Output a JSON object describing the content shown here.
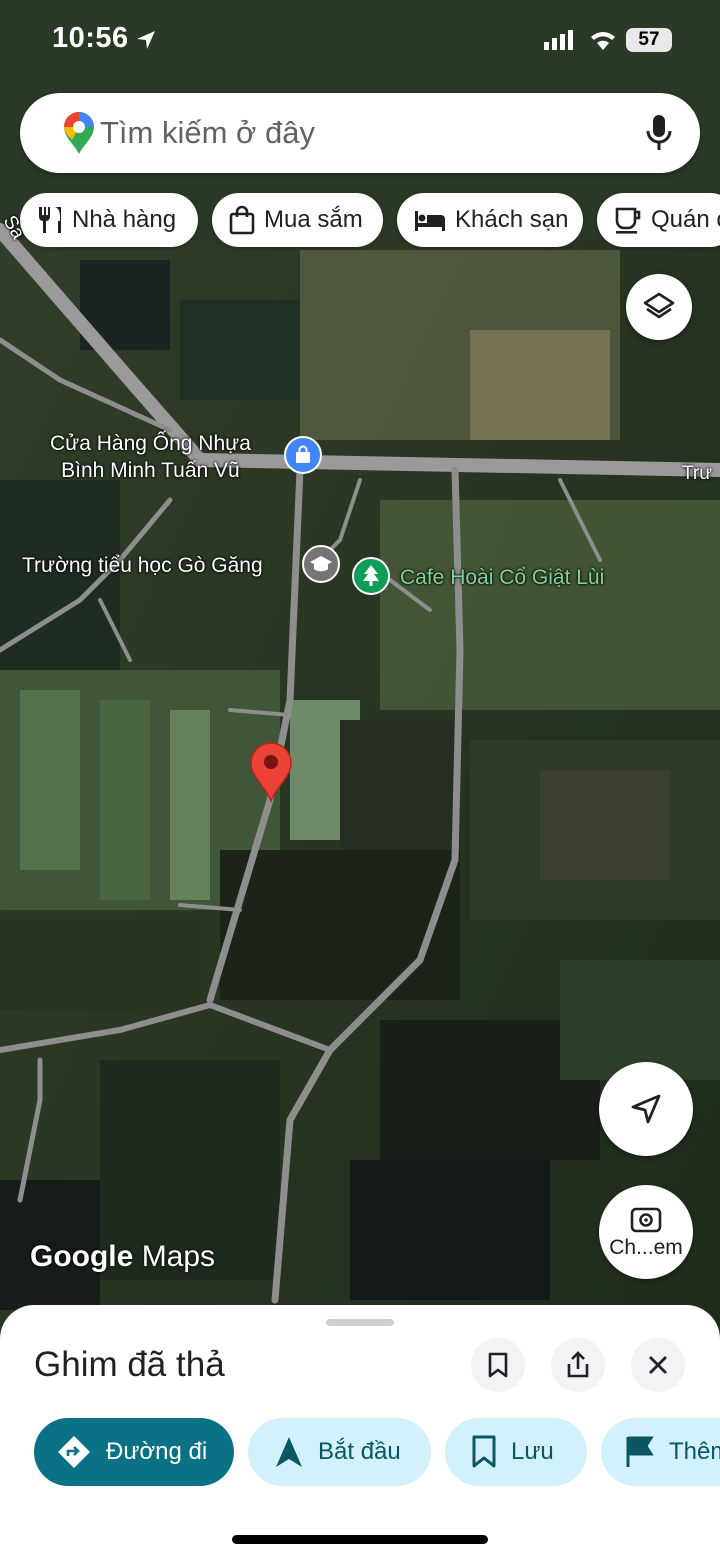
{
  "status_bar": {
    "time": "10:56",
    "battery": "57"
  },
  "search": {
    "placeholder": "Tìm kiếm ở đây"
  },
  "chips": [
    {
      "label": "Nhà hàng",
      "icon": "fork-knife-icon"
    },
    {
      "label": "Mua sắm",
      "icon": "shopping-bag-icon"
    },
    {
      "label": "Khách sạn",
      "icon": "bed-icon"
    },
    {
      "label": "Quán c",
      "icon": "coffee-cup-icon"
    }
  ],
  "map": {
    "road_labels": {
      "top_left": "Sa",
      "right": "Trư"
    },
    "places": [
      {
        "name": "Cửa Hàng Ống Nhựa\nBình Minh Tuấn Vũ",
        "icon": "shopping-bag-icon",
        "color": "#4285f4"
      },
      {
        "name": "Trường tiểu học Gò Găng",
        "icon": "school-icon",
        "color": "#757575"
      },
      {
        "name": "Cafe Hoài Cổ Giật Lùi",
        "icon": "tree-icon",
        "color": "#0f9d58"
      }
    ],
    "pin_color": "#ea4335",
    "layers_button": "layers-icon",
    "locate_button": "navigation-arrow-icon",
    "lens_button_label": "Ch...em",
    "watermark": {
      "google": "Google",
      "maps": "Maps"
    }
  },
  "sheet": {
    "title": "Ghim đã thả",
    "icons": [
      "bookmark-icon",
      "share-icon",
      "close-icon"
    ],
    "actions": [
      {
        "label": "Đường đi",
        "icon": "directions-icon"
      },
      {
        "label": "Bắt đầu",
        "icon": "navigation-arrow-icon"
      },
      {
        "label": "Lưu",
        "icon": "bookmark-icon"
      },
      {
        "label": "Thêm",
        "icon": "flag-icon"
      }
    ],
    "colors": {
      "primary": "#0b7285",
      "action_bg": "#d3f1fa",
      "action_text": "#0b5663"
    }
  }
}
